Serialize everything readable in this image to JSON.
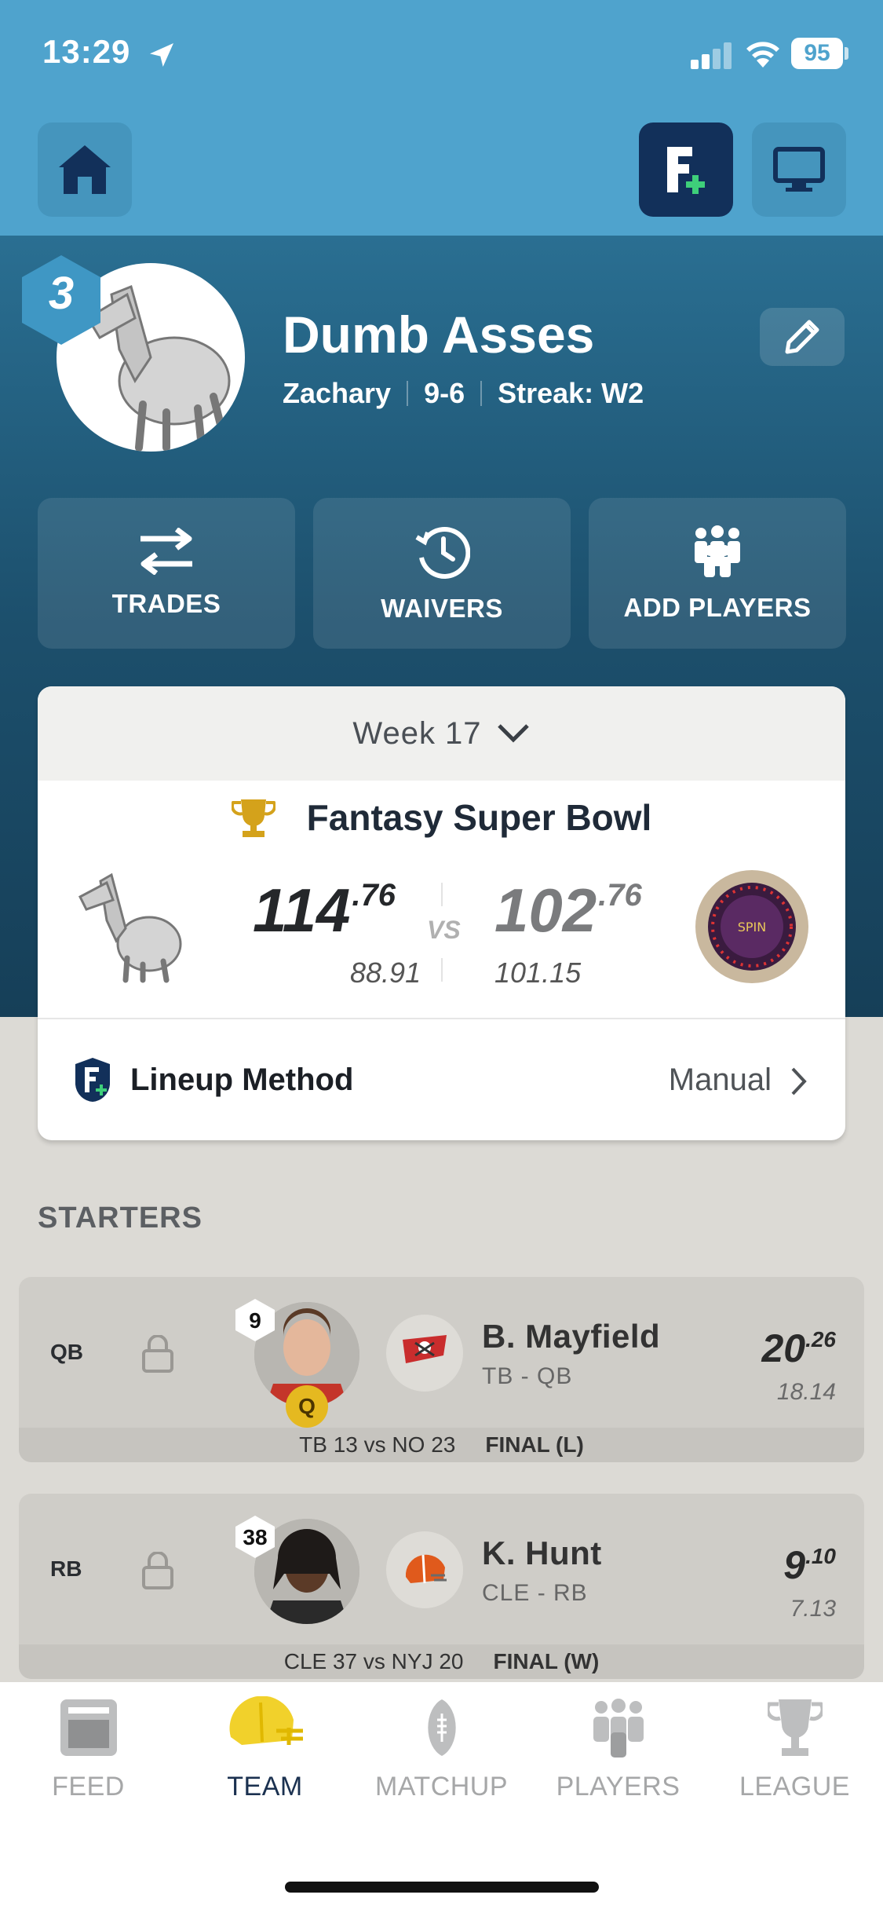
{
  "status_bar": {
    "time": "13:29",
    "battery": "95"
  },
  "team": {
    "rank": "3",
    "name": "Dumb Asses",
    "owner": "Zachary",
    "record": "9-6",
    "streak": "Streak: W2"
  },
  "actions": [
    {
      "label": "TRADES",
      "icon": "trade-arrows-icon"
    },
    {
      "label": "WAIVERS",
      "icon": "clock-history-icon"
    },
    {
      "label": "ADD PLAYERS",
      "icon": "people-group-icon"
    }
  ],
  "matchup": {
    "week": "Week 17",
    "title": "Fantasy Super Bowl",
    "my_score_int": "114",
    "my_score_dec": ".76",
    "my_projected": "88.91",
    "vs": "VS",
    "opp_score_int": "102",
    "opp_score_dec": ".76",
    "opp_projected": "101.15",
    "opp_logo_text": "SPIN"
  },
  "lineup": {
    "label": "Lineup Method",
    "value": "Manual"
  },
  "starters_label": "STARTERS",
  "players": [
    {
      "pos": "QB",
      "number": "9",
      "status": "Q",
      "name": "B. Mayfield",
      "team_pos": "TB - QB",
      "points_int": "20",
      "points_dec": ".26",
      "projected": "18.14",
      "game": "TB 13 vs NO 23",
      "result": "FINAL (L)"
    },
    {
      "pos": "RB",
      "number": "38",
      "name": "K. Hunt",
      "team_pos": "CLE - RB",
      "points_int": "9",
      "points_dec": ".10",
      "projected": "7.13",
      "game": "CLE 37 vs NYJ 20",
      "result": "FINAL (W)"
    }
  ],
  "nav": [
    {
      "label": "FEED",
      "active": false
    },
    {
      "label": "TEAM",
      "active": true
    },
    {
      "label": "MATCHUP",
      "active": false
    },
    {
      "label": "PLAYERS",
      "active": false
    },
    {
      "label": "LEAGUE",
      "active": false
    }
  ],
  "colors": {
    "header_blue": "#4fa3cd",
    "team_dark": "#1c4f6c",
    "accent_gold": "#e5b920",
    "nav_active": "#1b3150"
  }
}
